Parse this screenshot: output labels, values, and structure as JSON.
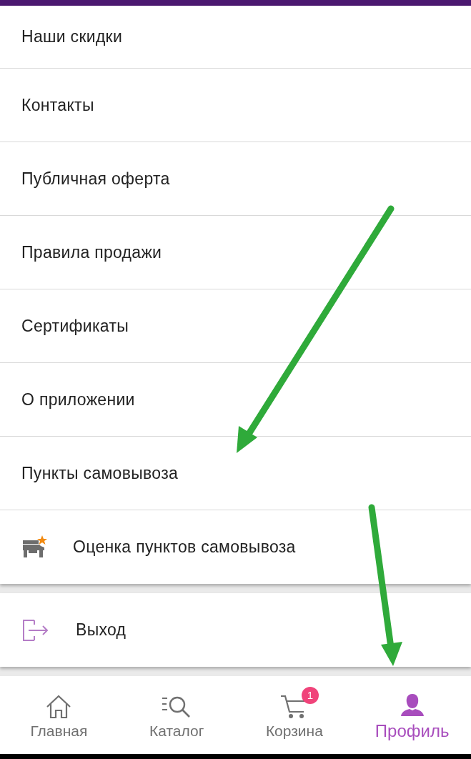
{
  "menu": [
    {
      "kind": "plain",
      "label": "Наши скидки"
    },
    {
      "kind": "plain",
      "label": "Контакты"
    },
    {
      "kind": "plain",
      "label": "Публичная оферта"
    },
    {
      "kind": "plain",
      "label": "Правила продажи"
    },
    {
      "kind": "plain",
      "label": "Сертификаты"
    },
    {
      "kind": "plain",
      "label": "О приложении"
    },
    {
      "kind": "plain",
      "label": "Пункты самовывоза"
    },
    {
      "kind": "store",
      "label": "Оценка пунктов самовывоза"
    }
  ],
  "logout": {
    "label": "Выход"
  },
  "nav": [
    {
      "label": "Главная",
      "selected": false
    },
    {
      "label": "Каталог",
      "selected": false
    },
    {
      "label": "Корзина",
      "selected": false,
      "badge": "1"
    },
    {
      "label": "Профиль",
      "selected": true
    }
  ]
}
